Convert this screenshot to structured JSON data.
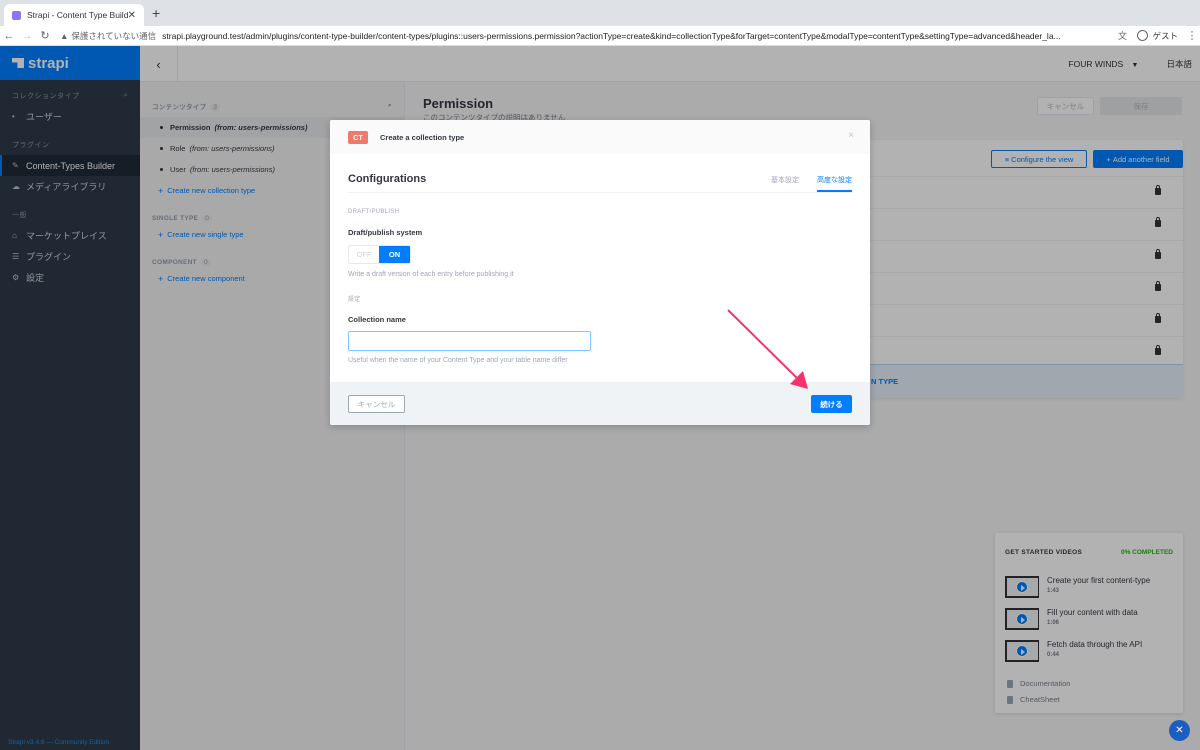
{
  "browser": {
    "tab_title": "Strapi - Content Type Builder",
    "tab_close": "✕",
    "new_tab": "+",
    "security_label": "保護されていない通信",
    "url": "strapi.playground.test/admin/plugins/content-type-builder/content-types/plugins::users-permissions.permission?actionType=create&kind=collectionType&forTarget=contentType&modalType=contentType&settingType=advanced&header_la...",
    "profile": "ゲスト"
  },
  "sidebar": {
    "brand": "strapi",
    "sections": {
      "collections": "コレクションタイプ",
      "plugins": "プラグイン",
      "general": "一般"
    },
    "collection_items": [
      {
        "label": "ユーザー"
      }
    ],
    "plugin_items": [
      {
        "label": "Content-Types Builder"
      },
      {
        "label": "メディアライブラリ"
      }
    ],
    "general_items": [
      {
        "label": "マーケットプレイス"
      },
      {
        "label": "プラグイン"
      },
      {
        "label": "設定"
      }
    ],
    "version": "Strapi v3.4.6 — Community Edition"
  },
  "header": {
    "project": "FOUR WINDS",
    "language": "日本語"
  },
  "ctpanel": {
    "content_types_label": "コンテンツタイプ",
    "content_types_count": "3",
    "items": [
      {
        "name": "Permission",
        "source": "(from: users-permissions)"
      },
      {
        "name": "Role",
        "source": "(from: users-permissions)"
      },
      {
        "name": "User",
        "source": "(from: users-permissions)"
      }
    ],
    "create_collection": "Create new collection type",
    "single_label": "SINGLE TYPE",
    "single_count": "0",
    "create_single": "Create new single type",
    "component_label": "COMPONENT",
    "component_count": "0",
    "create_component": "Create new component"
  },
  "main": {
    "title": "Permission",
    "description": "このコンテンツタイプの説明はありません",
    "cancel": "キャンセル",
    "save": "保存",
    "configure_view": "Configure the view",
    "add_field": "Add another field",
    "add_relation_partial": "N TYPE"
  },
  "modal": {
    "badge": "CT",
    "title": "Create a collection type",
    "close": "×",
    "config_title": "Configurations",
    "tabs": [
      "基本設定",
      "高度な設定"
    ],
    "draft_section": "DRAFT/PUBLISH",
    "draft_label": "Draft/publish system",
    "toggle_off": "OFF",
    "toggle_on": "ON",
    "draft_hint": "Write a draft version of each entry before publishing it",
    "settings_section": "設定",
    "collection_name_label": "Collection name",
    "collection_name_value": "",
    "collection_name_hint": "Useful when the name of your Content Type and your table name differ",
    "cancel": "キャンセル",
    "continue": "続ける"
  },
  "getstarted": {
    "title": "GET STARTED VIDEOS",
    "progress": "0% COMPLETED",
    "videos": [
      {
        "title": "Create your first content-type",
        "duration": "1:43"
      },
      {
        "title": "Fill your content with data",
        "duration": "1:06"
      },
      {
        "title": "Fetch data through the API",
        "duration": "0:44"
      }
    ],
    "links": [
      "Documentation",
      "CheatSheet"
    ]
  },
  "colors": {
    "accent": "#007eff",
    "sidebar": "#2e3a4a",
    "annotation_arrow": "#f5346e"
  }
}
